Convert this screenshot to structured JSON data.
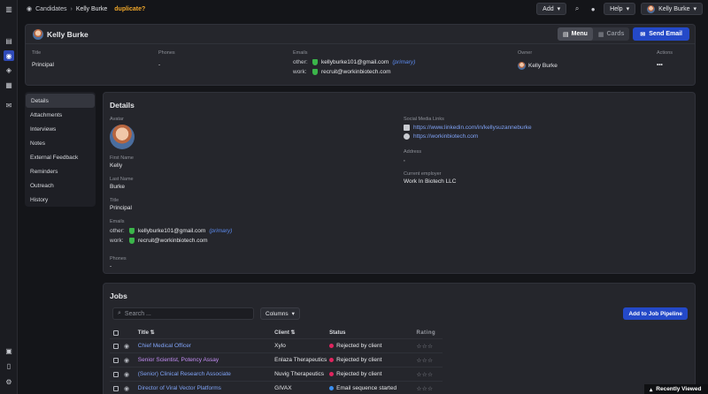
{
  "breadcrumb": {
    "section": "Candidates",
    "current": "Kelly Burke",
    "flag": "duplicate?"
  },
  "topbar": {
    "add_label": "Add",
    "help_label": "Help",
    "user_label": "Kelly Burke"
  },
  "header": {
    "name": "Kelly Burke",
    "menu_label": "Menu",
    "cards_label": "Cards",
    "send_email_label": "Send Email",
    "labels": {
      "title": "Title",
      "phones": "Phones",
      "emails": "Emails",
      "owner": "Owner",
      "actions": "Actions"
    },
    "title_value": "Principal",
    "phones_value": "-",
    "emails": [
      {
        "kind": "other:",
        "address": "kellyburke101@gmail.com",
        "tag": "(primary)"
      },
      {
        "kind": "work:",
        "address": "recruit@workinbiotech.com",
        "tag": ""
      }
    ],
    "owner_name": "Kelly Burke",
    "actions_value": "•••"
  },
  "nav": {
    "items": [
      "Details",
      "Attachments",
      "Interviews",
      "Notes",
      "External Feedback",
      "Reminders",
      "Outreach",
      "History"
    ],
    "active": "Details"
  },
  "details": {
    "heading": "Details",
    "avatar_label": "Avatar",
    "first_name_label": "First Name",
    "first_name": "Kelly",
    "last_name_label": "Last Name",
    "last_name": "Burke",
    "title_label": "Title",
    "title": "Principal",
    "emails_label": "Emails",
    "phones_label": "Phones",
    "phones": "-",
    "social_label": "Social Media Links",
    "social": [
      "https://www.linkedin.com/in/kellysuzanneburke",
      "https://workinbiotech.com"
    ],
    "address_label": "Address",
    "address": ",",
    "employer_label": "Current employer",
    "employer": "Work In Biotech LLC"
  },
  "jobs": {
    "heading": "Jobs",
    "search_placeholder": "Search ...",
    "columns_label": "Columns",
    "add_label": "Add to Job Pipeline",
    "headers": {
      "title": "Title ⇅",
      "client": "Client ⇅",
      "status": "Status",
      "rating": "Rating"
    },
    "rows": [
      {
        "title": "Chief Medical Officer",
        "client": "Xylo",
        "status": "Rejected by client",
        "rating": "☆☆☆",
        "title_color": "#7fa2f5",
        "status_color": "#e0245e"
      },
      {
        "title": "Senior Scientist, Potency Assay",
        "client": "Enlaza Therapeutics",
        "status": "Rejected by client",
        "rating": "☆☆☆",
        "title_color": "#c48ef5",
        "status_color": "#e0245e"
      },
      {
        "title": "(Senior) Clinical Research Associate",
        "client": "Nuvig Therapeutics",
        "status": "Rejected by client",
        "rating": "☆☆☆",
        "title_color": "#7fa2f5",
        "status_color": "#e0245e"
      },
      {
        "title": "Director of Viral Vector Platforms",
        "client": "GIVAX",
        "status": "Email sequence started",
        "rating": "☆☆☆",
        "title_color": "#7fa2f5",
        "status_color": "#3b8ff0"
      }
    ]
  },
  "recent_label": "Recently Viewed",
  "colors": {
    "accent": "#2449c8",
    "warning": "#f0a72a",
    "success": "#3bb54a"
  }
}
